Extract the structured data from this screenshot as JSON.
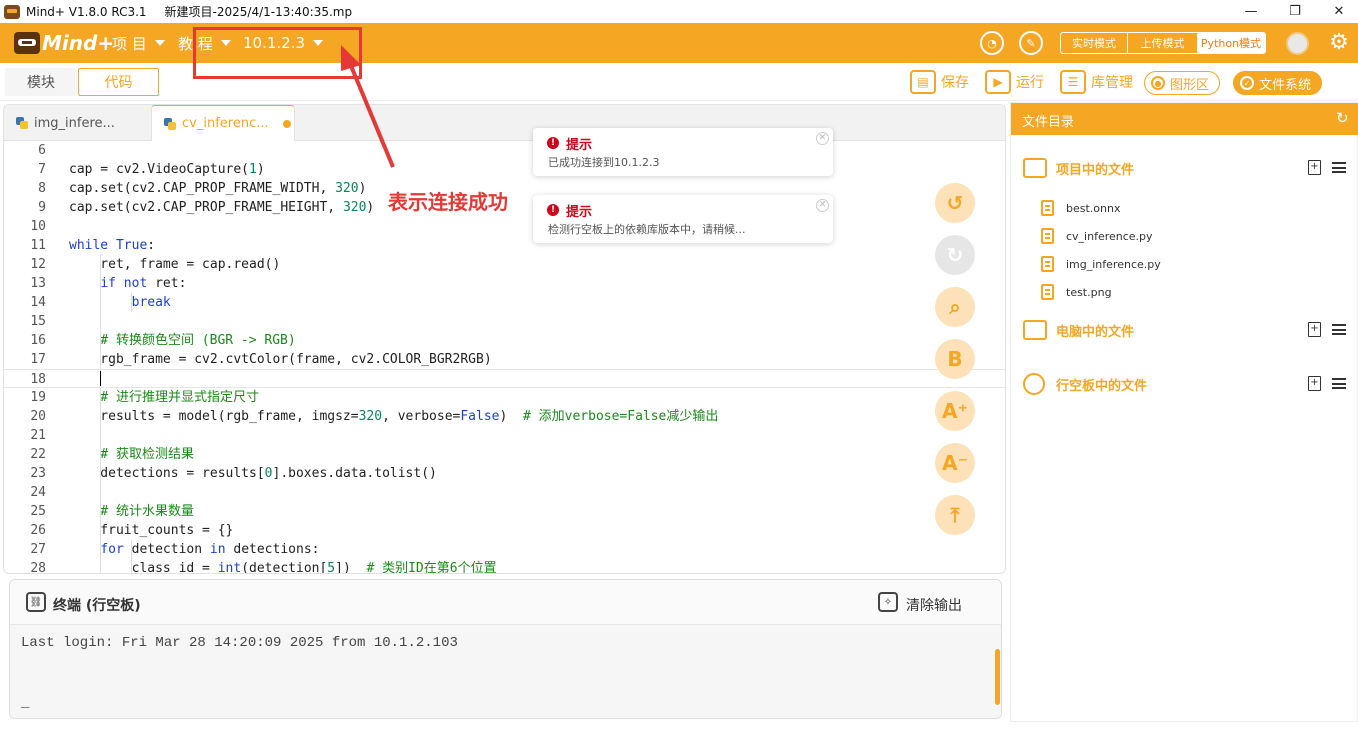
{
  "window": {
    "app_title": "Mind+ V1.8.0 RC3.1",
    "project_title": "新建项目-2025/4/1-13:40:35.mp",
    "minimize": "—",
    "restore": "❐",
    "close": "✕"
  },
  "menubar": {
    "logo_text": "Mind+",
    "project": "项 目",
    "tutorial": "教 程",
    "device": "10.1.2.3",
    "modes": [
      "实时模式",
      "上传模式",
      "Python模式"
    ],
    "active_mode": "Python模式"
  },
  "toolbar": {
    "blocks_tab": "模块",
    "code_tab": "代码",
    "save": "保存",
    "run": "运行",
    "library": "库管理",
    "graphics": "图形区",
    "filesystem": "文件系统"
  },
  "editor": {
    "tabs": [
      {
        "label": "img_infere...",
        "active": false
      },
      {
        "label": "cv_inferenc...",
        "active": true,
        "modified": true
      }
    ],
    "lines": [
      {
        "n": "6",
        "text": ""
      },
      {
        "n": "7",
        "text": "cap = cv2.VideoCapture(1)"
      },
      {
        "n": "8",
        "text": "cap.set(cv2.CAP_PROP_FRAME_WIDTH, 320)"
      },
      {
        "n": "9",
        "text": "cap.set(cv2.CAP_PROP_FRAME_HEIGHT, 320)"
      },
      {
        "n": "10",
        "text": ""
      },
      {
        "n": "11",
        "text": "while True:"
      },
      {
        "n": "12",
        "text": "    ret, frame = cap.read()"
      },
      {
        "n": "13",
        "text": "    if not ret:"
      },
      {
        "n": "14",
        "text": "        break"
      },
      {
        "n": "15",
        "text": ""
      },
      {
        "n": "16",
        "text": "    # 转换颜色空间 (BGR -> RGB)"
      },
      {
        "n": "17",
        "text": "    rgb_frame = cv2.cvtColor(frame, cv2.COLOR_BGR2RGB)"
      },
      {
        "n": "18",
        "text": "    "
      },
      {
        "n": "19",
        "text": "    # 进行推理并显式指定尺寸"
      },
      {
        "n": "20",
        "text": "    results = model(rgb_frame, imgsz=320, verbose=False)  # 添加verbose=False减少输出"
      },
      {
        "n": "21",
        "text": ""
      },
      {
        "n": "22",
        "text": "    # 获取检测结果"
      },
      {
        "n": "23",
        "text": "    detections = results[0].boxes.data.tolist()"
      },
      {
        "n": "24",
        "text": ""
      },
      {
        "n": "25",
        "text": "    # 统计水果数量"
      },
      {
        "n": "26",
        "text": "    fruit_counts = {}"
      },
      {
        "n": "27",
        "text": "    for detection in detections:"
      },
      {
        "n": "28",
        "text": "        class_id = int(detection[5])  # 类别ID在第6个位置"
      }
    ]
  },
  "notifications": [
    {
      "title": "提示",
      "message": "已成功连接到10.1.2.3"
    },
    {
      "title": "提示",
      "message": "检测行空板上的依赖库版本中，请稍候..."
    }
  ],
  "annotation": {
    "text": "表示连接成功",
    "color": "#e53935"
  },
  "terminal": {
    "title": "终端 (行空板)",
    "clear": "清除输出",
    "output_line": "Last login: Fri Mar 28 14:20:09 2025 from 10.1.2.103",
    "prompt": "_"
  },
  "file_panel": {
    "title": "文件目录",
    "sections": [
      {
        "label": "项目中的文件",
        "files": [
          "best.onnx",
          "cv_inference.py",
          "img_inference.py",
          "test.png"
        ]
      },
      {
        "label": "电脑中的文件",
        "files": []
      },
      {
        "label": "行空板中的文件",
        "files": []
      }
    ]
  },
  "colors": {
    "accent": "#f5a623",
    "error": "#d0021b",
    "keyword": "#1b3fd6",
    "comment": "#1a8a1a",
    "number": "#098658"
  }
}
